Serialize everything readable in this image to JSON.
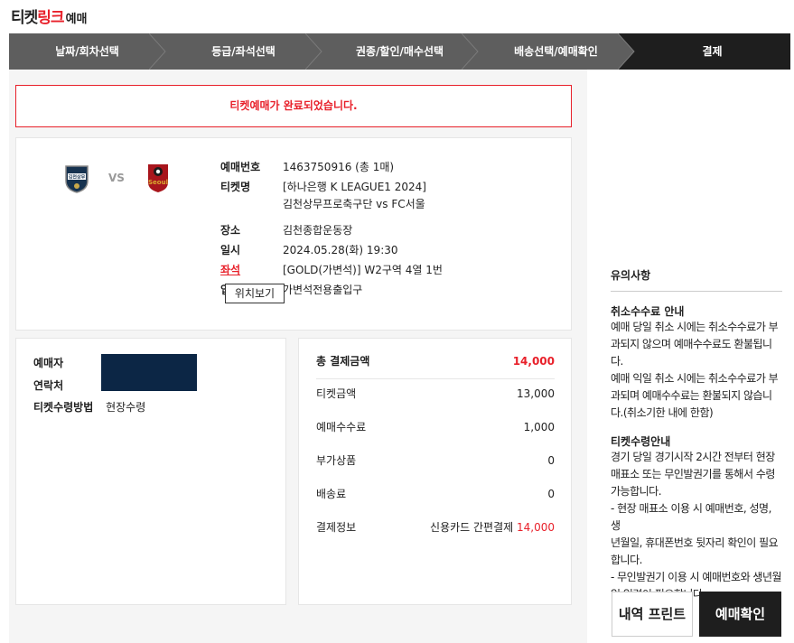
{
  "logo": {
    "part1": "티켓",
    "part2": "링크",
    "part3": "예매"
  },
  "steps": [
    "날짜/회차선택",
    "등급/좌석선택",
    "권종/할인/매수선택",
    "배송선택/예매확인",
    "결제"
  ],
  "done_message": "티켓예매가 완료되었습니다.",
  "match": {
    "vs": "VS",
    "home_emblem": "김천상무",
    "away_emblem": "Seoul"
  },
  "booking": {
    "no_label": "예매번호",
    "no_value": "1463750916 (총 1매)",
    "ticket_label": "티켓명",
    "ticket_line1": "[하나은행 K LEAGUE1 2024]",
    "ticket_line2": "김천상무프로축구단 vs FC서울",
    "venue_label": "장소",
    "venue_value": "김천종합운동장",
    "date_label": "일시",
    "date_value": "2024.05.28(화) 19:30",
    "seat_label": "좌석",
    "seat_value": "[GOLD(가변석)] W2구역 4열 1번",
    "gate_label": "입장",
    "gate_value": "가변석전용출입구",
    "tooltip": "위치보기"
  },
  "buyer": {
    "name_label": "예매자",
    "contact_label": "연락처",
    "method_label": "티켓수령방법",
    "method_value": "현장수령"
  },
  "payment": {
    "total_label": "총 결제금액",
    "total_value": "14,000",
    "ticket_label": "티켓금액",
    "ticket_value": "13,000",
    "fee_label": "예매수수료",
    "fee_value": "1,000",
    "extra_label": "부가상품",
    "extra_value": "0",
    "delivery_label": "배송료",
    "delivery_value": "0",
    "info_label": "결제정보",
    "info_method": "신용카드 간편결제",
    "info_amount": "14,000"
  },
  "notice": {
    "title": "유의사항",
    "cancel_title": "취소수수료 안내",
    "cancel_l1": "예매 당일 취소 시에는 취소수수료가 부",
    "cancel_l2": "과되지 않으며 예매수수료도 환불됩니",
    "cancel_l3": "다.",
    "cancel_l4": "예매 익일 취소 시에는 취소수수료가 부",
    "cancel_l5": "과되며 예매수수료는 환불되지 않습니",
    "cancel_l6": "다.(취소기한 내에 한함)",
    "receive_title": "티켓수령안내",
    "receive_l1": "경기 당일 경기시작 2시간 전부터 현장",
    "receive_l2": "매표소 또는 무인발권기를 통해서 수령",
    "receive_l3": "가능합니다.",
    "receive_l4": "- 현장 매표소 이용 시 예매번호, 성명, 생",
    "receive_l5": "년월일, 휴대폰번호 뒷자리 확인이 필요",
    "receive_l6": "합니다.",
    "receive_l7": "- 무인발권기 이용 시 예매번호와 생년월",
    "receive_l8": "일 입력이 필요합니다."
  },
  "buttons": {
    "print": "내역 프린트",
    "confirm": "예매확인"
  },
  "colors": {
    "accent": "#e8202a",
    "dark": "#1e1e1e",
    "step_bg": "#5e5e5e",
    "mask": "#0c2645"
  }
}
